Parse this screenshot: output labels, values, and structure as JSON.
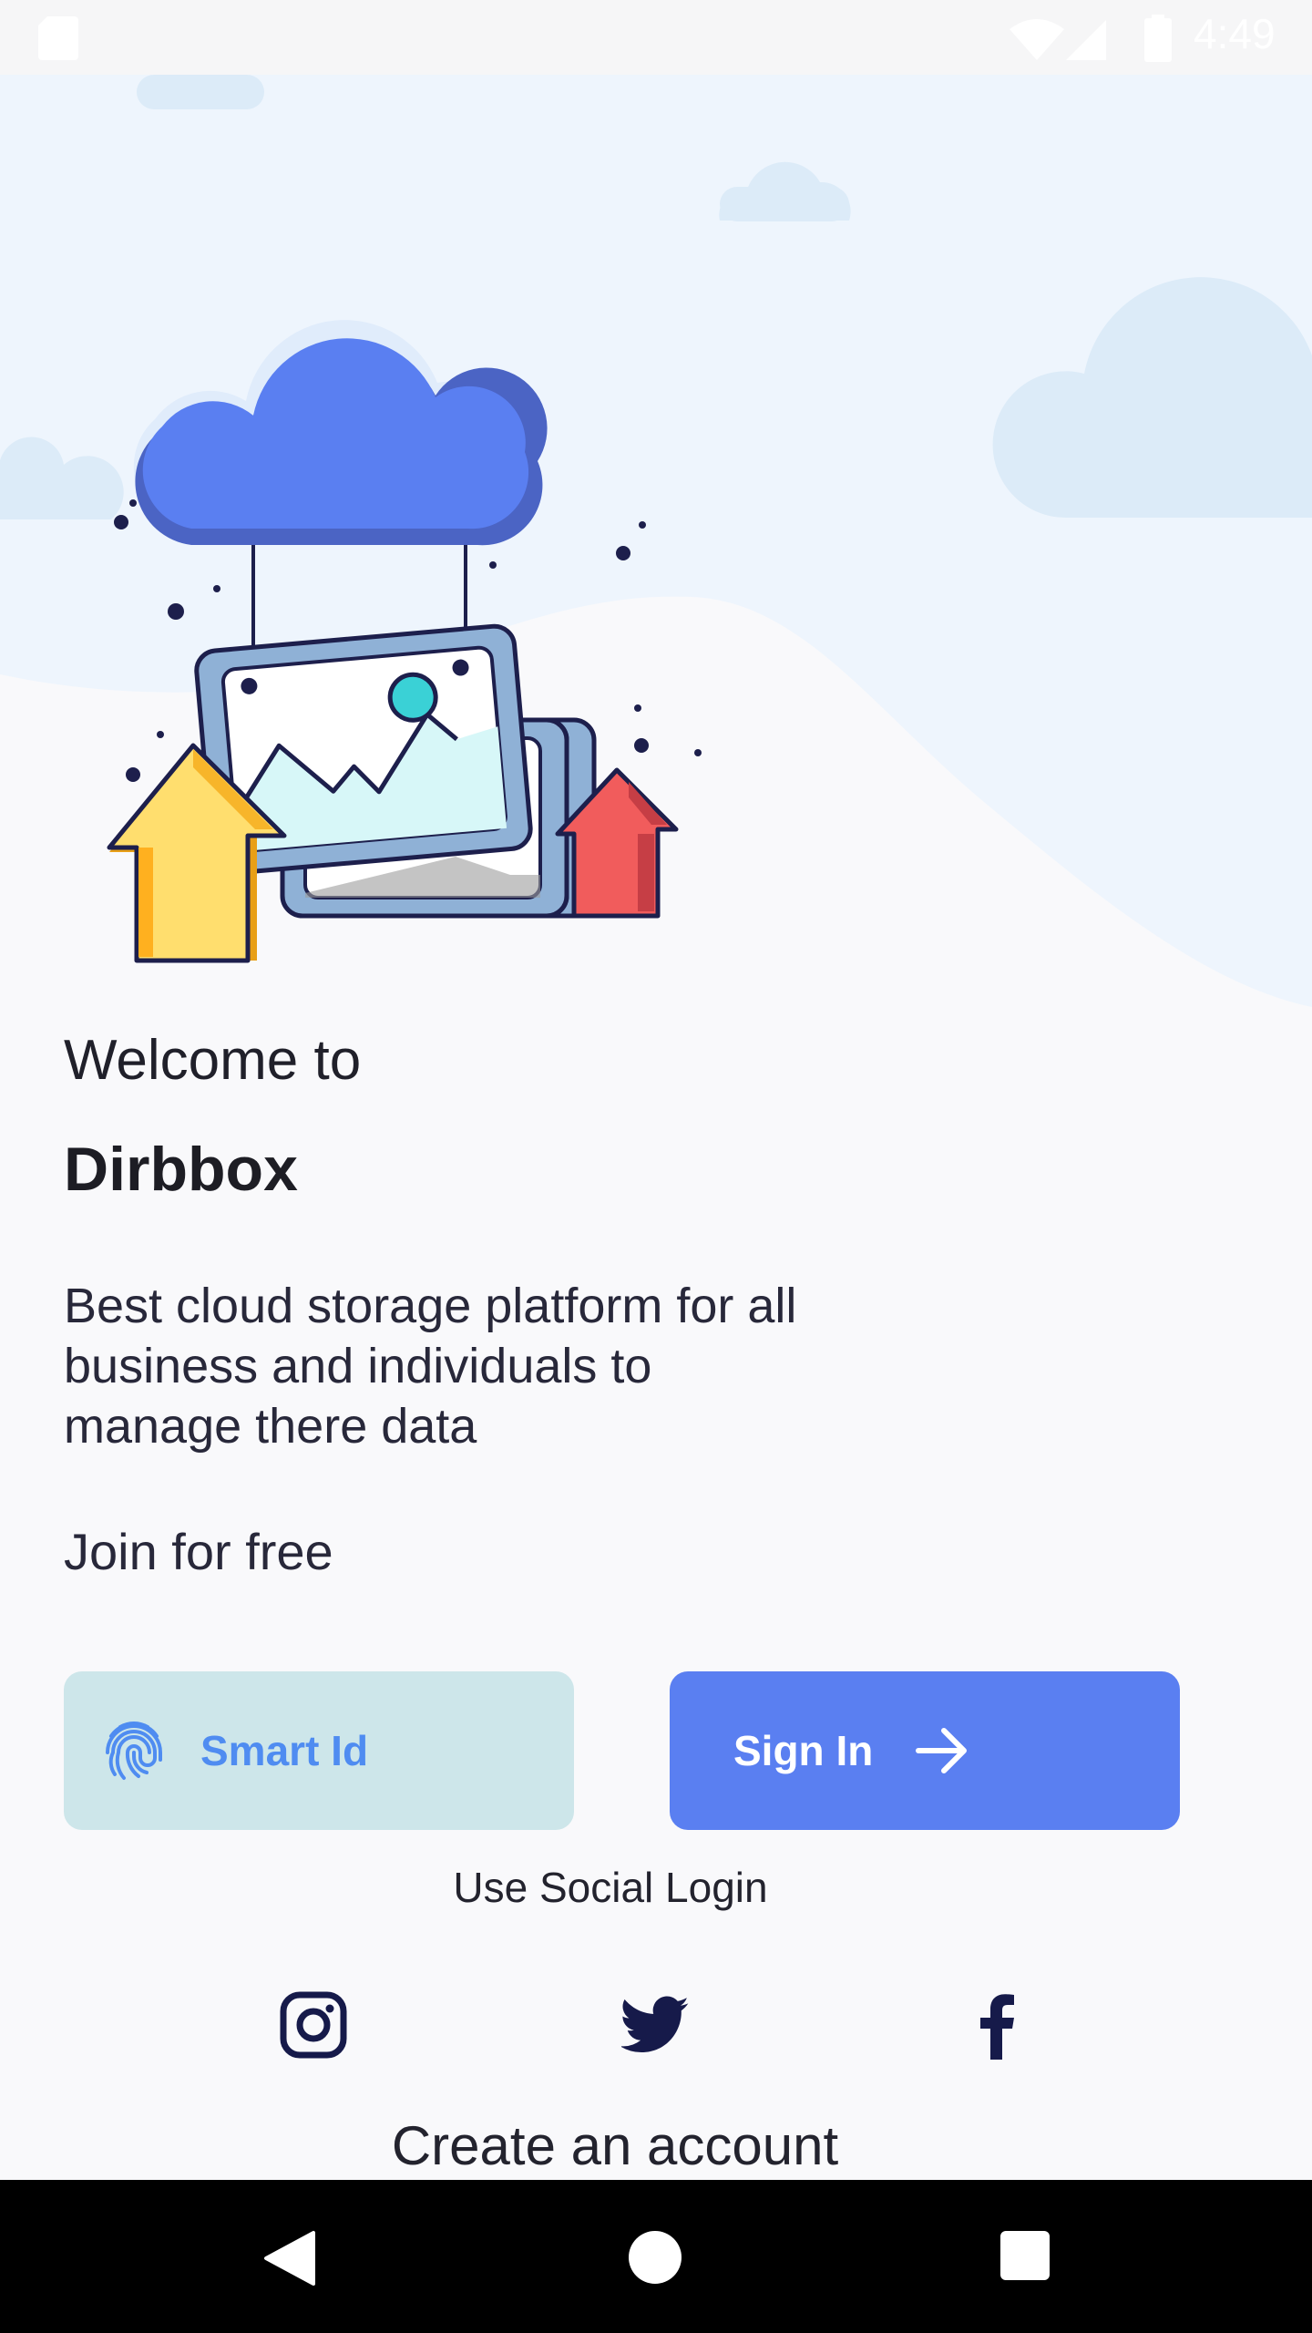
{
  "status_bar": {
    "time": "4:49",
    "icons": [
      "sd-card-icon",
      "wifi-icon",
      "signal-icon",
      "battery-icon"
    ]
  },
  "welcome": {
    "line1": "Welcome to",
    "brand": "Dirbbox",
    "description": "Best cloud storage platform for all\n business and individuals to\n manage there data",
    "join": "Join for free"
  },
  "buttons": {
    "smart_id": {
      "label": "Smart Id",
      "icon": "fingerprint-icon"
    },
    "sign_in": {
      "label": "Sign In",
      "icon": "arrow-right-icon"
    }
  },
  "social": {
    "title": "Use Social Login",
    "icons": [
      "instagram-icon",
      "twitter-icon",
      "facebook-icon"
    ]
  },
  "create_account": "Create an account",
  "colors": {
    "primary": "#5a7ff1",
    "smart_bg": "#cde6ea",
    "smart_text": "#4f8cf1",
    "dark_icon": "#161a4a",
    "background": "#f9f9fb"
  },
  "nav_bar": {
    "icons": [
      "back-icon",
      "home-icon",
      "recents-icon"
    ]
  }
}
